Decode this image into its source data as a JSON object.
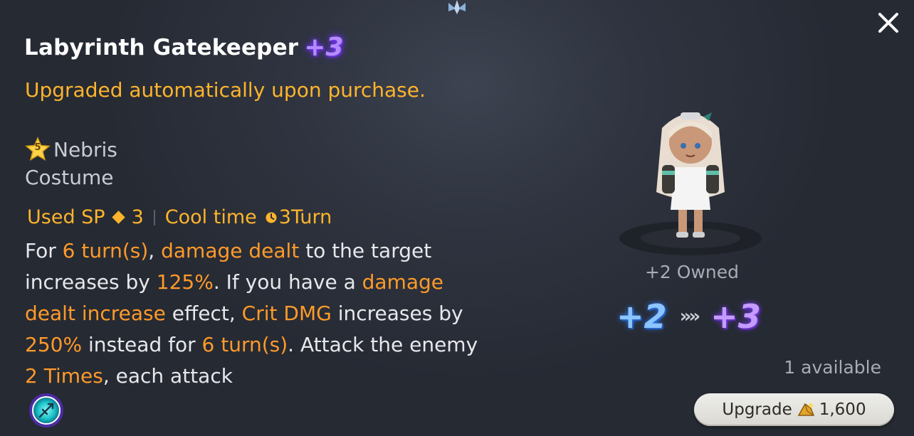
{
  "window": {
    "close_icon": "close-icon"
  },
  "item": {
    "name": "Labyrinth Gatekeeper",
    "plus_level": "+3",
    "auto_upgrade_note": "Upgraded automatically upon purchase."
  },
  "character": {
    "star_rank": "5",
    "name": "Nebris",
    "type": "Costume"
  },
  "skill": {
    "used_sp_label": "Used SP",
    "used_sp_value": "3",
    "cool_time_label": "Cool time",
    "cool_time_value": "3Turn",
    "description": [
      {
        "t": "For ",
        "h": false
      },
      {
        "t": "6 turn(s)",
        "h": true
      },
      {
        "t": ", ",
        "h": false
      },
      {
        "t": "damage dealt",
        "h": true
      },
      {
        "t": " to the target increases by ",
        "h": false
      },
      {
        "t": "125%",
        "h": true
      },
      {
        "t": ". If you have a ",
        "h": false
      },
      {
        "t": "damage dealt increase",
        "h": true
      },
      {
        "t": " effect, ",
        "h": false
      },
      {
        "t": "Crit DMG",
        "h": true
      },
      {
        "t": " increases by ",
        "h": false
      },
      {
        "t": "250%",
        "h": true
      },
      {
        "t": " instead for ",
        "h": false
      },
      {
        "t": "6 turn(s)",
        "h": true
      },
      {
        "t": ". Attack the enemy ",
        "h": false
      },
      {
        "t": "2 Times",
        "h": true
      },
      {
        "t": ", each attack",
        "h": false
      }
    ]
  },
  "upgrade": {
    "owned_text": "+2 Owned",
    "from_level": "+2",
    "to_level": "+3",
    "arrows": "»»",
    "available_text": "1 available",
    "button_label": "Upgrade",
    "cost": "1,600"
  },
  "colors": {
    "accent_orange": "#ffb42c",
    "highlight_orange": "#ff9a2a",
    "purple_plus": "#b58cff",
    "blue_plus": "#8cc4ff"
  }
}
